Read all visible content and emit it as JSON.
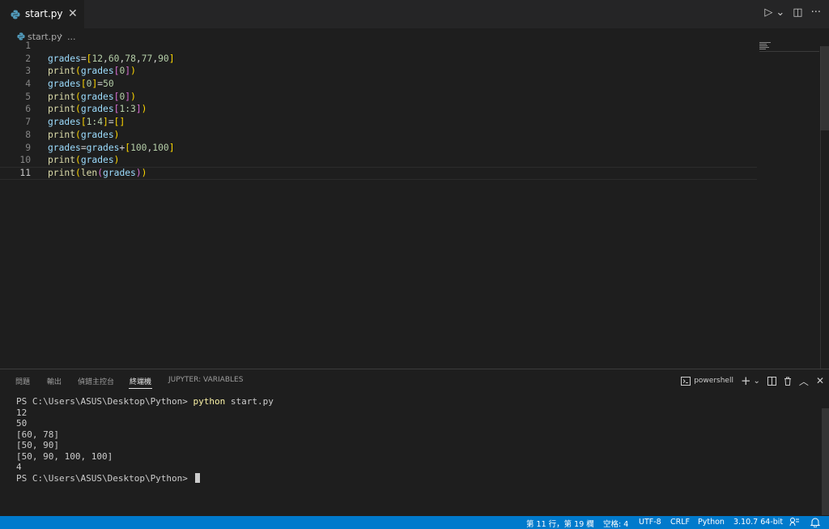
{
  "tab": {
    "filename": "start.py",
    "close": "✕"
  },
  "editor_actions": {
    "run": "▷",
    "run_menu": "⌄",
    "split": "◫",
    "more": "···"
  },
  "breadcrumb": {
    "file": "start.py",
    "sep": "›",
    "ellipsis": "..."
  },
  "line_numbers": [
    "1",
    "2",
    "3",
    "4",
    "5",
    "6",
    "7",
    "8",
    "9",
    "10",
    "11"
  ],
  "code": {
    "l2": [
      "grades",
      "=",
      "[",
      "12",
      "",
      ",",
      "60",
      ",",
      "78",
      ",",
      "77",
      ",",
      "90",
      "]"
    ],
    "l3": [
      "print",
      "(",
      "grades",
      "[",
      "0",
      "]",
      ")"
    ],
    "l4": [
      "grades",
      "[",
      "0",
      "]",
      "=",
      "50"
    ],
    "l5": [
      "print",
      "(",
      "grades",
      "[",
      "0",
      "]",
      ")"
    ],
    "l6": [
      "print",
      "(",
      "grades",
      "[",
      "1:3",
      "]",
      ")"
    ],
    "l7": [
      "grades",
      "[",
      "1:4",
      "]",
      "=",
      "[]"
    ],
    "l8": [
      "print",
      "(",
      "grades",
      ")"
    ],
    "l9": [
      "grades",
      "=",
      "grades",
      "+",
      "[",
      "100",
      ",",
      "100",
      "]"
    ],
    "l10": [
      "print",
      "(",
      "grades",
      ")"
    ],
    "l11": [
      "print",
      "(",
      "len",
      "(",
      "grades",
      ")",
      ")"
    ]
  },
  "panel": {
    "tabs": [
      "問題",
      "輸出",
      "偵錯主控台",
      "終端機",
      "JUPYTER: VARIABLES"
    ],
    "shell": "powershell"
  },
  "terminal": {
    "prompt": "PS C:\\Users\\ASUS\\Desktop\\Python> ",
    "command": "python",
    "args": " start.py",
    "output": [
      "12",
      "50",
      "[60, 78]",
      "[50, 90]",
      "[50, 90, 100, 100]",
      "4"
    ],
    "final_prompt": "PS C:\\Users\\ASUS\\Desktop\\Python> "
  },
  "status": {
    "position": "第 11 行，第 19 欄",
    "spaces": "空格: 4",
    "encoding": "UTF-8",
    "eol": "CRLF",
    "language": "Python",
    "interpreter": "3.10.7 64-bit"
  }
}
